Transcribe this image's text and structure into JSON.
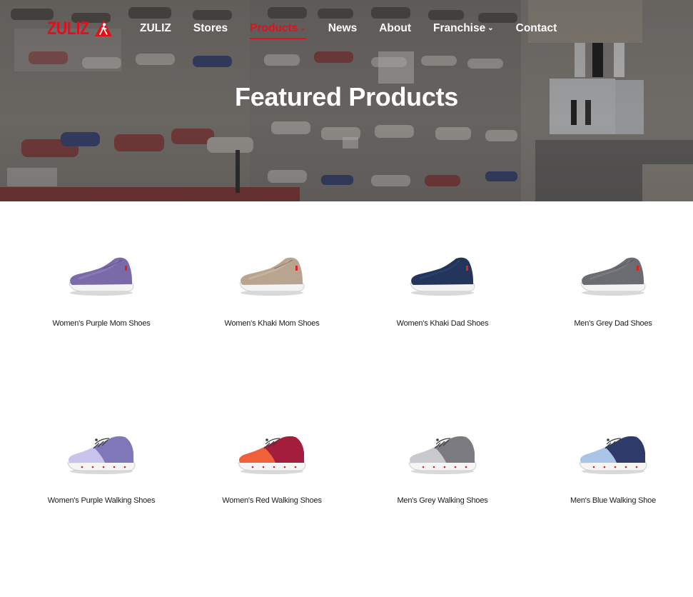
{
  "brand": {
    "logo_text": "ZULIZ",
    "accent_color": "#e3101c"
  },
  "nav": {
    "items": [
      {
        "label": "ZULIZ",
        "active": false,
        "has_dropdown": false
      },
      {
        "label": "Stores",
        "active": false,
        "has_dropdown": false
      },
      {
        "label": "Products",
        "active": true,
        "has_dropdown": true
      },
      {
        "label": "News",
        "active": false,
        "has_dropdown": false
      },
      {
        "label": "About",
        "active": false,
        "has_dropdown": false
      },
      {
        "label": "Franchise",
        "active": false,
        "has_dropdown": true
      },
      {
        "label": "Contact",
        "active": false,
        "has_dropdown": false
      }
    ],
    "dropdown_icon": "chevron-down-icon"
  },
  "hero": {
    "title": "Featured Products"
  },
  "products": [
    {
      "name": "Women's Purple Mom Shoes",
      "style": "slip-on",
      "upper_color": "#7b6aa8",
      "accent_color": "#8d7cbc"
    },
    {
      "name": "Women's Khaki Mom Shoes",
      "style": "slip-on",
      "upper_color": "#b9a48f",
      "accent_color": "#c8b6a2"
    },
    {
      "name": "Women's Khaki Dad Shoes",
      "style": "slip-on",
      "upper_color": "#23355a",
      "accent_color": "#2d4270"
    },
    {
      "name": "Men's Grey Dad Shoes",
      "style": "slip-on",
      "upper_color": "#6b6c72",
      "accent_color": "#7d7e85"
    },
    {
      "name": "Women's Purple Walking Shoes",
      "style": "walking",
      "upper_color": "#7e77b8",
      "accent_color": "#c9c3ee"
    },
    {
      "name": "Women's Red Walking Shoes",
      "style": "walking",
      "upper_color": "#a51d3c",
      "accent_color": "#f0603a"
    },
    {
      "name": "Men's Grey Walking Shoes",
      "style": "walking",
      "upper_color": "#7a7a80",
      "accent_color": "#c9c9cd"
    },
    {
      "name": "Men's Blue Walking Shoe",
      "style": "walking",
      "upper_color": "#2e3b6a",
      "accent_color": "#a9c4e6"
    }
  ]
}
